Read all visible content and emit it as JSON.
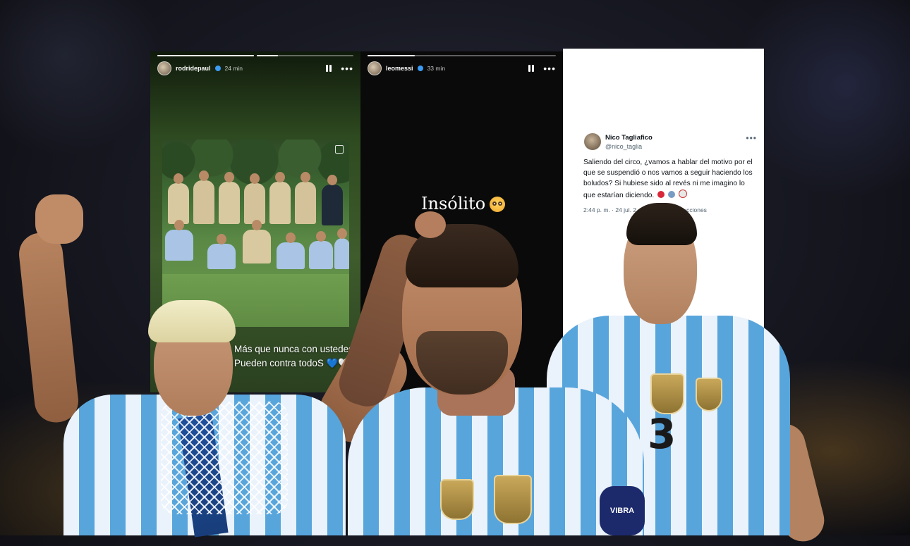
{
  "story_left": {
    "username": "rodridepaul",
    "time_ago": "24 min",
    "progress": [
      1.0,
      0.22
    ],
    "caption_line_1": "Más que nunca con ustedes!",
    "caption_line_2": "Pueden contra todoS 💙🤍",
    "icons": [
      "pause-icon",
      "more-icon",
      "verified-icon"
    ]
  },
  "story_center": {
    "username": "leomessi",
    "time_ago": "33 min",
    "progress": [
      0.25
    ],
    "text": "Insólito",
    "emoji": "flushed-face",
    "icons": [
      "pause-icon",
      "more-icon",
      "verified-icon"
    ]
  },
  "tweet": {
    "name": "Nico Tagliafico",
    "handle": "@nico_taglia",
    "body": "Saliendo del circo, ¿vamos a hablar del motivo por el que se suspendió o nos vamos a seguir haciendo los boludos? Si hubiese sido al revés ni me imagino lo que estarían diciendo.",
    "emojis": [
      "angry-face",
      "person-facepalming",
      "clown-face"
    ],
    "meta": "2:44 p. m. · 24 jul. 2",
    "meta_end": "Reproducciones"
  },
  "foreground": {
    "jersey_number": "3",
    "captain_band": "VIBRA"
  },
  "colors": {
    "jersey_light": "#eaf2fb",
    "jersey_blue": "#58a5dc",
    "verified": "#3b9bf5",
    "twitter_text": "#0f1419",
    "twitter_muted": "#536471"
  }
}
